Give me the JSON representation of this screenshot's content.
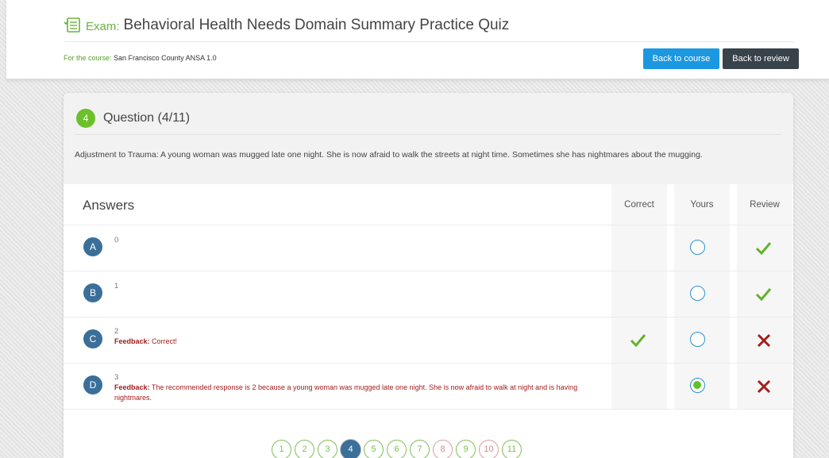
{
  "header": {
    "exam_prefix": "Exam:",
    "exam_title": "Behavioral Health Needs Domain Summary Practice Quiz",
    "course_label": "For the course:",
    "course_name": "San Francisco County ANSA 1.0",
    "back_to_course": "Back to course",
    "back_to_review": "Back to review"
  },
  "question": {
    "number": "4",
    "title": "Question (4/11)",
    "text": "Adjustment to Trauma: A young woman was mugged late one night. She is now afraid to walk the streets at night time. Sometimes she has nightmares about the mugging."
  },
  "answers": {
    "heading": "Answers",
    "columns": [
      "Correct",
      "Yours",
      "Review"
    ],
    "rows": [
      {
        "letter": "A",
        "value": "0",
        "feedback_label": "",
        "feedback": "",
        "correct": false,
        "selected": false,
        "review": "correct"
      },
      {
        "letter": "B",
        "value": "1",
        "feedback_label": "",
        "feedback": "",
        "correct": false,
        "selected": false,
        "review": "correct"
      },
      {
        "letter": "C",
        "value": "2",
        "feedback_label": "Feedback:",
        "feedback": "Correct!",
        "correct": true,
        "selected": false,
        "review": "wrong"
      },
      {
        "letter": "D",
        "value": "3",
        "feedback_label": "Feedback:",
        "feedback": "The recommended response is 2 because a young woman was mugged late one night. She is now afraid to walk at night and is having nightmares.",
        "correct": false,
        "selected": true,
        "review": "wrong"
      }
    ]
  },
  "pagination": {
    "pages": [
      "1",
      "2",
      "3",
      "4",
      "5",
      "6",
      "7",
      "8",
      "9",
      "10",
      "11"
    ],
    "current": "4",
    "incorrect": [
      "8",
      "10"
    ]
  },
  "colors": {
    "accent_green": "#6cc02c",
    "primary_blue": "#1b98e0",
    "dark_button": "#37424a",
    "letter_blue": "#3a6f99",
    "feedback_red": "#a31d1d"
  }
}
